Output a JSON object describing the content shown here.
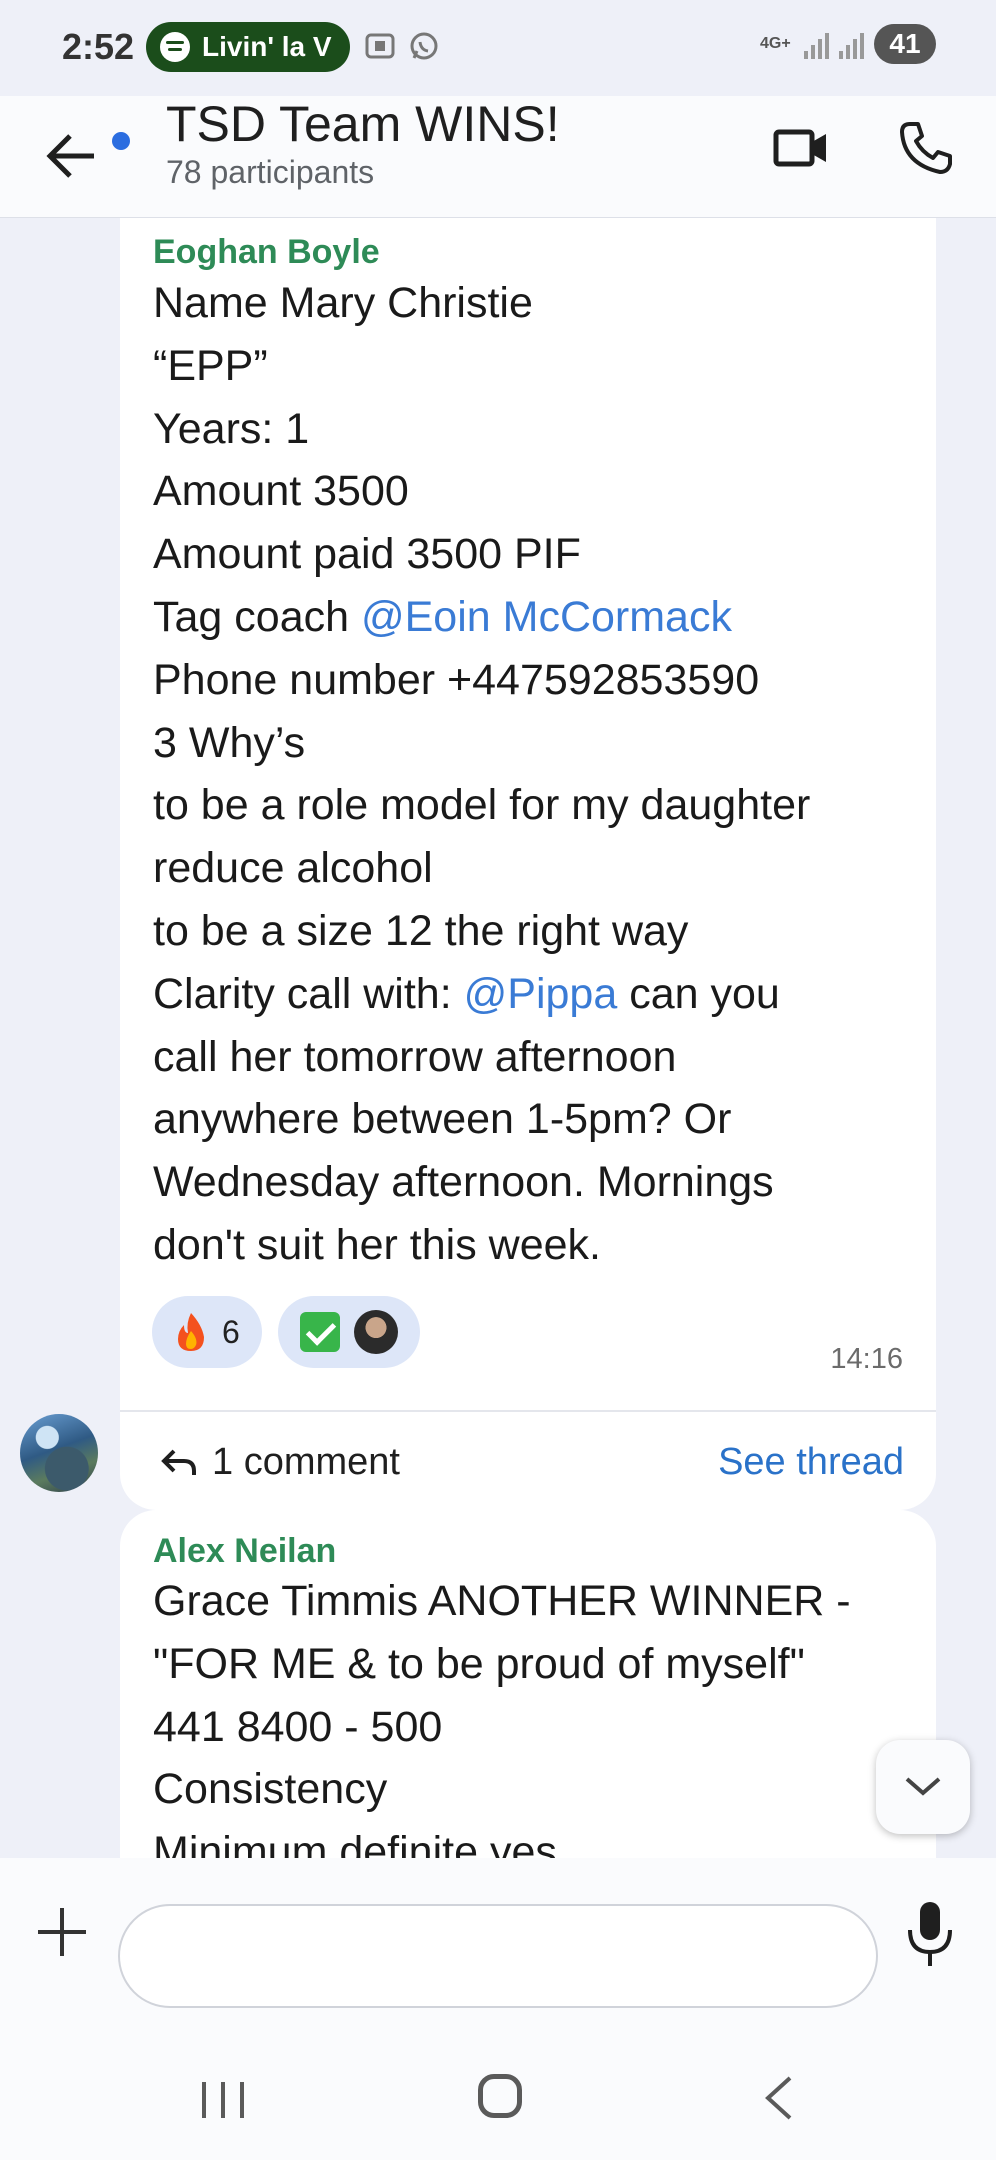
{
  "status_bar": {
    "time": "2:52",
    "media_pill": "Livin' la V",
    "network": "4G+",
    "battery": "41"
  },
  "header": {
    "title": "TSD Team WINS!",
    "subtitle": "78 participants"
  },
  "messages": [
    {
      "sender": "Eoghan Boyle",
      "lines": [
        "Name Mary Christie",
        "“EPP”",
        "Years: 1",
        "Amount 3500",
        "Amount paid 3500 PIF",
        {
          "prefix": "Tag coach ",
          "mention": "@Eoin McCormack"
        },
        "Phone number +447592853590",
        "3 Why’s",
        "to be a role model for my daughter",
        "reduce alcohol",
        "to be a size 12 the right way",
        {
          "prefix": "Clarity call with: ",
          "mention": "@Pippa",
          "suffix": " can you"
        },
        "call her tomorrow afternoon",
        "anywhere between 1-5pm? Or",
        "Wednesday afternoon. Mornings",
        "don't suit her this week."
      ],
      "reactions": [
        {
          "emoji": "fire-icon",
          "count": "6"
        },
        {
          "emoji": "check-mark-icon",
          "reactor": "avatar"
        }
      ],
      "time": "14:16",
      "comment_count": "1 comment",
      "see_thread": "See thread"
    },
    {
      "sender": "Alex Neilan",
      "lines": [
        "Grace Timmis ANOTHER WINNER -",
        "\"FOR ME & to be proud of myself\"",
        "441 8400 - 500",
        "Consistency",
        "Minimum definite yes"
      ]
    }
  ],
  "composer": {
    "placeholder": ""
  },
  "colors": {
    "sender_name": "#2e8b57",
    "mention": "#3a7bd5",
    "link": "#2a72c9",
    "background": "#eef0f8"
  }
}
